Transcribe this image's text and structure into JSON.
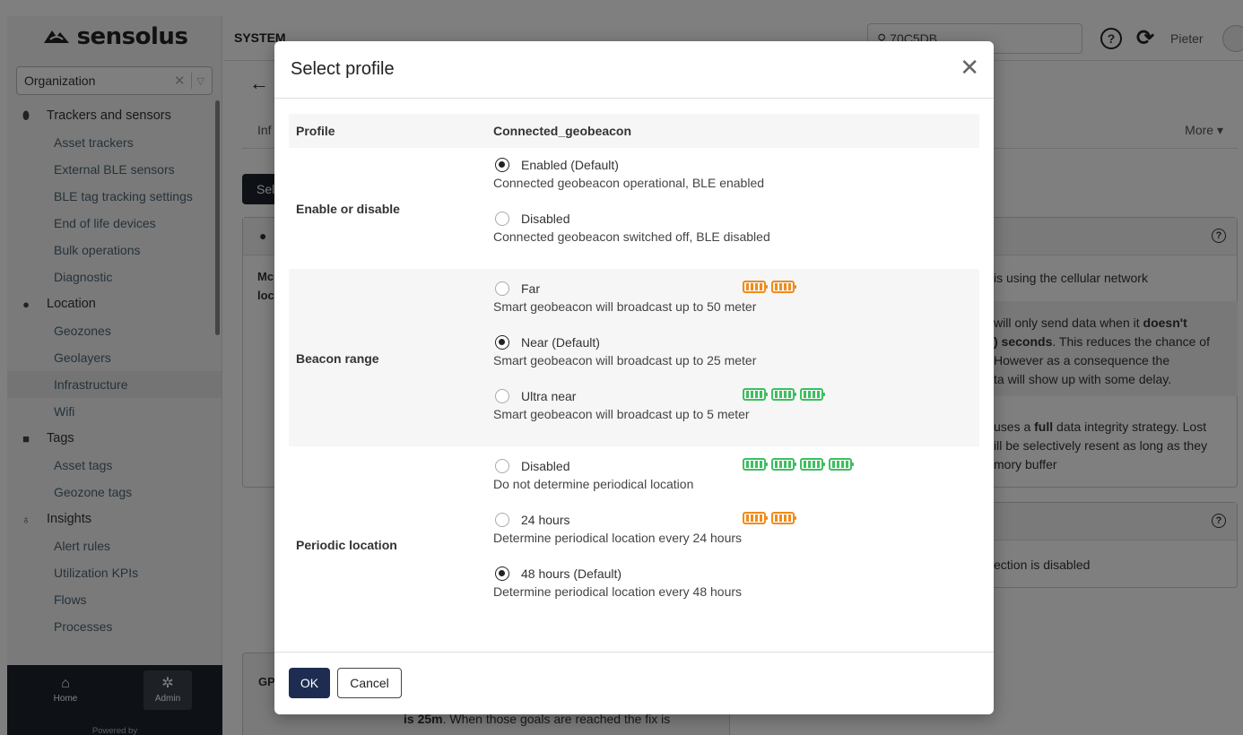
{
  "sidebar": {
    "logo": "sensolus",
    "organization_select": "Organization",
    "groups": [
      {
        "label": "Trackers and sensors",
        "icon": "tracker-icon",
        "items": [
          "Asset trackers",
          "External BLE sensors",
          "BLE tag tracking settings",
          "End of life devices",
          "Bulk operations",
          "Diagnostic"
        ]
      },
      {
        "label": "Location",
        "icon": "location-pin-icon",
        "items": [
          "Geozones",
          "Geolayers",
          "Infrastructure",
          "Wifi"
        ]
      },
      {
        "label": "Tags",
        "icon": "tag-icon",
        "items": [
          "Asset tags",
          "Geozone tags"
        ]
      },
      {
        "label": "Insights",
        "icon": "lightbulb-icon",
        "items": [
          "Alert rules",
          "Utilization KPIs",
          "Flows",
          "Processes"
        ]
      }
    ],
    "active_item": "Infrastructure",
    "bottom": {
      "home_label": "Home",
      "admin_label": "Admin",
      "powered_by": "Powered by"
    }
  },
  "topbar": {
    "section": "SYSTEM",
    "search_value": "70C5DB",
    "user_name": "Pieter"
  },
  "background": {
    "tab_info": "Inf",
    "more_label": "More",
    "select_button": "Sel",
    "panel_left_text": "Mc loc",
    "gps_label": "GP",
    "cellular_text": "is using the cellular network",
    "delay_text_1": "will only send data when it",
    "delay_bold_1": "doesn't",
    "delay_bold_2": ") seconds",
    "delay_text_2": ". This reduces the chance of",
    "delay_text_3": "However as a consequence the",
    "delay_text_4": "ta will show up with some delay.",
    "integrity_text_1": "uses a",
    "integrity_bold": "full",
    "integrity_text_2": "data integrity strategy. Lost",
    "integrity_text_3": "ill be selectively resent as long as they",
    "integrity_text_4": "mory buffer",
    "detection_text": "ection is disabled",
    "bottom_bold": "is 25m",
    "bottom_text": ". When those goals are reached the fix is"
  },
  "modal": {
    "title": "Select profile",
    "profile_label": "Profile",
    "profile_value": "Connected_geobeacon",
    "sections": [
      {
        "label": "Enable or disable",
        "options": [
          {
            "label": "Enabled (Default)",
            "desc": "Connected geobeacon operational, BLE enabled",
            "checked": true,
            "battery": []
          },
          {
            "label": "Disabled",
            "desc": "Connected geobeacon switched off, BLE disabled",
            "checked": false,
            "battery": []
          }
        ]
      },
      {
        "label": "Beacon range",
        "options": [
          {
            "label": "Far",
            "desc": "Smart geobeacon will broadcast up to 50 meter",
            "checked": false,
            "battery": [
              "orange",
              "orange"
            ]
          },
          {
            "label": "Near (Default)",
            "desc": "Smart geobeacon will broadcast up to 25 meter",
            "checked": true,
            "battery": []
          },
          {
            "label": "Ultra near",
            "desc": "Smart geobeacon will broadcast up to 5 meter",
            "checked": false,
            "battery": [
              "green",
              "green",
              "green"
            ]
          }
        ]
      },
      {
        "label": "Periodic location",
        "options": [
          {
            "label": "Disabled",
            "desc": "Do not determine periodical location",
            "checked": false,
            "battery": [
              "green",
              "green",
              "green",
              "green"
            ]
          },
          {
            "label": "24 hours",
            "desc": "Determine periodical location every 24 hours",
            "checked": false,
            "battery": [
              "orange",
              "orange"
            ]
          },
          {
            "label": "48 hours (Default)",
            "desc": "Determine periodical location every 48 hours",
            "checked": true,
            "battery": []
          }
        ]
      }
    ],
    "ok_label": "OK",
    "cancel_label": "Cancel"
  },
  "colors": {
    "battery_orange": "#f08c1a",
    "battery_green": "#3cbf60",
    "primary_button": "#1d2c50"
  }
}
